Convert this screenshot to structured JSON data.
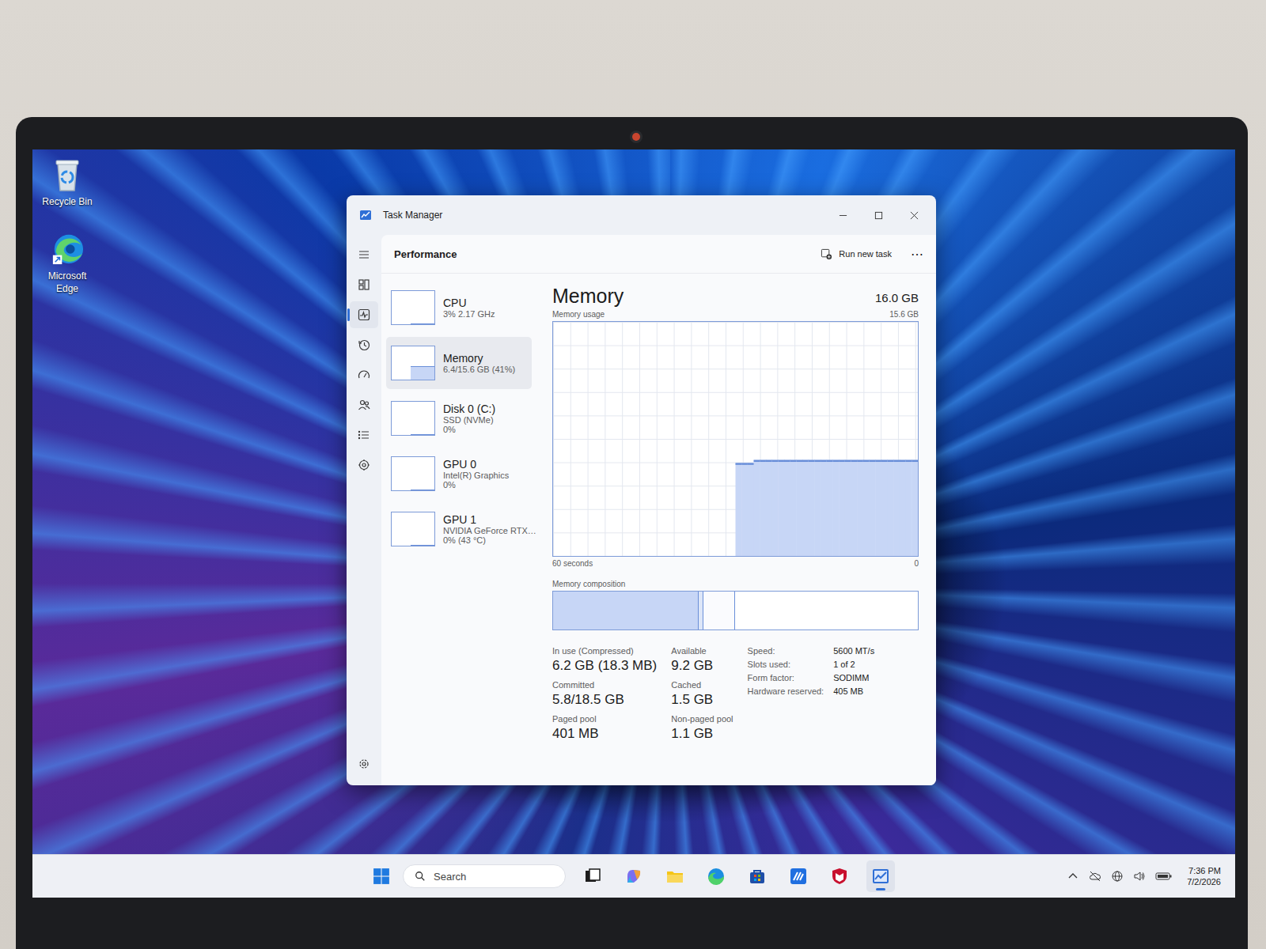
{
  "desktop": {
    "icons": [
      {
        "label": "Recycle Bin"
      },
      {
        "label": "Microsoft Edge"
      }
    ]
  },
  "window": {
    "title": "Task Manager",
    "section": "Performance",
    "run_task": "Run new task",
    "more": "⋯"
  },
  "nav": [
    {
      "selected": false
    },
    {
      "selected": false
    },
    {
      "selected": true
    },
    {
      "selected": false
    },
    {
      "selected": false
    },
    {
      "selected": false
    },
    {
      "selected": false
    },
    {
      "selected": false
    },
    {
      "selected": false
    }
  ],
  "resources": [
    {
      "name": "CPU",
      "detail": "3% 2.17 GHz",
      "level": 0.03,
      "selected": false
    },
    {
      "name": "Memory",
      "detail": "6.4/15.6 GB (41%)",
      "level": 0.41,
      "selected": true
    },
    {
      "name": "Disk 0 (C:)",
      "subtitle": "SSD (NVMe)",
      "detail": "0%",
      "level": 0,
      "selected": false
    },
    {
      "name": "GPU 0",
      "subtitle": "Intel(R) Graphics",
      "detail": "0%",
      "level": 0,
      "selected": false
    },
    {
      "name": "GPU 1",
      "subtitle": "NVIDIA GeForce RTX…",
      "detail": "0% (43 °C)",
      "level": 0,
      "selected": false
    }
  ],
  "memory": {
    "title": "Memory",
    "capacity": "16.0 GB",
    "chart": {
      "label": "Memory usage",
      "axis_max": "15.6 GB",
      "axis_left": "60 seconds",
      "axis_right": "0",
      "series": [
        0,
        0,
        0,
        0,
        0,
        0,
        0,
        0,
        0,
        0,
        0,
        0,
        0,
        0,
        0,
        0,
        0,
        0,
        0,
        0,
        0,
        0,
        0,
        0,
        0,
        0,
        0,
        0,
        0,
        0,
        6.2,
        6.2,
        6.2,
        6.4,
        6.4,
        6.4,
        6.4,
        6.4,
        6.4,
        6.4,
        6.4,
        6.4,
        6.4,
        6.4,
        6.4,
        6.4,
        6.4,
        6.4,
        6.4,
        6.4,
        6.4,
        6.4,
        6.4,
        6.4,
        6.4,
        6.4,
        6.4,
        6.4,
        6.4,
        6.4
      ]
    },
    "composition": {
      "label": "Memory composition",
      "segments": [
        {
          "kind": "in-use",
          "level": 0.4
        },
        {
          "kind": "modified",
          "level": 0.012
        },
        {
          "kind": "standby",
          "level": 0.088
        },
        {
          "kind": "free",
          "level": 0.5
        }
      ]
    },
    "stats": [
      {
        "label": "In use (Compressed)",
        "value": "6.2 GB (18.3 MB)"
      },
      {
        "label": "Available",
        "value": "9.2 GB"
      },
      {
        "label": "Committed",
        "value": "5.8/18.5 GB"
      },
      {
        "label": "Cached",
        "value": "1.5 GB"
      },
      {
        "label": "Paged pool",
        "value": "401 MB"
      },
      {
        "label": "Non-paged pool",
        "value": "1.1 GB"
      }
    ],
    "specs": [
      {
        "label": "Speed:",
        "value": "5600 MT/s"
      },
      {
        "label": "Slots used:",
        "value": "1 of 2"
      },
      {
        "label": "Form factor:",
        "value": "SODIMM"
      },
      {
        "label": "Hardware reserved:",
        "value": "405 MB"
      }
    ]
  },
  "taskbar": {
    "search": "Search",
    "apps": [
      {
        "active": false
      },
      {
        "active": false
      },
      {
        "active": false
      },
      {
        "active": false
      },
      {
        "active": false
      },
      {
        "active": false
      },
      {
        "active": false
      },
      {
        "active": true
      }
    ],
    "time": "7:36 PM",
    "date": "7/2/2026"
  }
}
